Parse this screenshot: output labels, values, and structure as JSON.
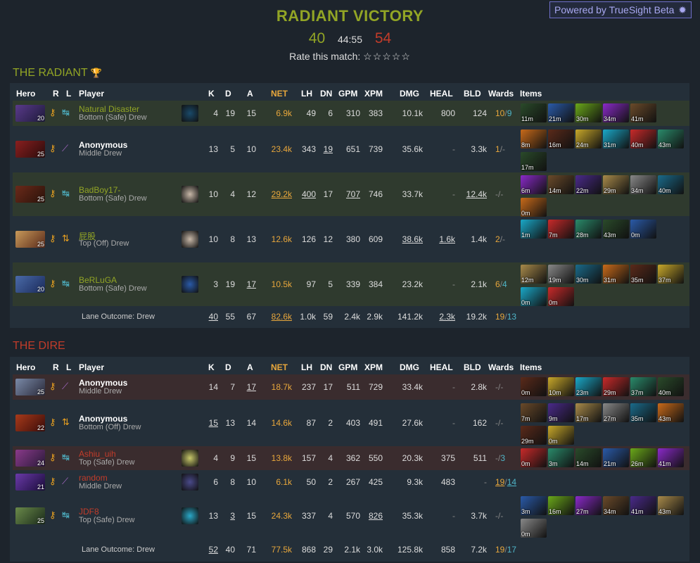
{
  "header": {
    "result": "RADIANT VICTORY",
    "radiant_score": "40",
    "duration": "44:55",
    "dire_score": "54",
    "rate_label": "Rate this match:",
    "stars": "☆☆☆☆☆",
    "powered": "Powered by TrueSight Beta"
  },
  "columns": {
    "hero": "Hero",
    "r": "R",
    "l": "L",
    "player": "Player",
    "k": "K",
    "d": "D",
    "a": "A",
    "net": "NET",
    "lh": "LH",
    "dn": "DN",
    "gpm": "GPM",
    "xpm": "XPM",
    "dmg": "DMG",
    "heal": "HEAL",
    "bld": "BLD",
    "wards": "Wards",
    "items": "Items"
  },
  "radiant": {
    "title": "THE RADIANT",
    "trophy": "🏆",
    "footer": {
      "label": "Lane Outcome: Drew",
      "k": "40",
      "d": "55",
      "a": "67",
      "net": "82.6k",
      "lh": "1.0k",
      "dn": "59",
      "gpm": "2.4k",
      "xpm": "2.9k",
      "dmg": "141.2k",
      "heal": "2.3k",
      "bld": "19.2k",
      "w1": "19",
      "w2": "13"
    },
    "players": [
      {
        "name": "Natural Disaster",
        "sub": "Bottom (Safe) Drew",
        "lvl": "20",
        "k": "4",
        "d": "19",
        "a": "15",
        "net": "6.9k",
        "lh": "49",
        "dn": "6",
        "gpm": "310",
        "xpm": "383",
        "dmg": "10.1k",
        "heal": "800",
        "bld": "124",
        "w1": "10",
        "w2": "9",
        "times": [
          "11m",
          "21m",
          "30m",
          "34m",
          "41m"
        ]
      },
      {
        "name": "Anonymous",
        "sub": "Middle Drew",
        "lvl": "25",
        "k": "13",
        "d": "5",
        "a": "10",
        "net": "23.4k",
        "lh": "343",
        "dn": "19",
        "gpm": "651",
        "xpm": "739",
        "dmg": "35.6k",
        "heal": "-",
        "bld": "3.3k",
        "w1": "1",
        "w2": "-",
        "times": [
          "8m",
          "16m",
          "24m",
          "31m",
          "40m",
          "43m",
          "17m"
        ]
      },
      {
        "name": "BadBoy17-",
        "sub": "Bottom (Safe) Drew",
        "lvl": "25",
        "k": "10",
        "d": "4",
        "a": "12",
        "net": "29.2k",
        "lh": "400",
        "dn": "17",
        "gpm": "707",
        "xpm": "746",
        "dmg": "33.7k",
        "heal": "-",
        "bld": "12.4k",
        "w1": "-",
        "w2": "-",
        "times": [
          "6m",
          "14m",
          "22m",
          "29m",
          "34m",
          "40m",
          "0m"
        ]
      },
      {
        "name": "屁股",
        "sub": "Top (Off) Drew",
        "lvl": "25",
        "k": "10",
        "d": "8",
        "a": "13",
        "net": "12.6k",
        "lh": "126",
        "dn": "12",
        "gpm": "380",
        "xpm": "609",
        "dmg": "38.6k",
        "heal": "1.6k",
        "bld": "1.4k",
        "w1": "2",
        "w2": "-",
        "times": [
          "1m",
          "7m",
          "28m",
          "43m",
          "0m"
        ]
      },
      {
        "name": "BeRLuGA",
        "sub": "Bottom (Safe) Drew",
        "lvl": "20",
        "k": "3",
        "d": "19",
        "a": "17",
        "net": "10.5k",
        "lh": "97",
        "dn": "5",
        "gpm": "339",
        "xpm": "384",
        "dmg": "23.2k",
        "heal": "-",
        "bld": "2.1k",
        "w1": "6",
        "w2": "4",
        "times": [
          "12m",
          "19m",
          "30m",
          "31m",
          "35m",
          "37m",
          "0m",
          "0m"
        ]
      }
    ]
  },
  "dire": {
    "title": "THE DIRE",
    "footer": {
      "label": "Lane Outcome: Drew",
      "k": "52",
      "d": "40",
      "a": "71",
      "net": "77.5k",
      "lh": "868",
      "dn": "29",
      "gpm": "2.1k",
      "xpm": "3.0k",
      "dmg": "125.8k",
      "heal": "858",
      "bld": "7.2k",
      "w1": "19",
      "w2": "17"
    },
    "players": [
      {
        "name": "Anonymous",
        "sub": "Middle Drew",
        "lvl": "25",
        "k": "14",
        "d": "7",
        "a": "17",
        "net": "18.7k",
        "lh": "237",
        "dn": "17",
        "gpm": "511",
        "xpm": "729",
        "dmg": "33.4k",
        "heal": "-",
        "bld": "2.8k",
        "w1": "-",
        "w2": "-",
        "times": [
          "0m",
          "10m",
          "23m",
          "29m",
          "37m",
          "40m"
        ]
      },
      {
        "name": "Anonymous",
        "sub": "Bottom (Off) Drew",
        "lvl": "22",
        "k": "15",
        "d": "13",
        "a": "14",
        "net": "14.6k",
        "lh": "87",
        "dn": "2",
        "gpm": "403",
        "xpm": "491",
        "dmg": "27.6k",
        "heal": "-",
        "bld": "162",
        "w1": "-",
        "w2": "-",
        "times": [
          "7m",
          "9m",
          "17m",
          "27m",
          "35m",
          "43m",
          "29m",
          "0m"
        ]
      },
      {
        "name": "Ashiu_uih",
        "sub": "Top (Safe) Drew",
        "lvl": "24",
        "k": "4",
        "d": "9",
        "a": "15",
        "net": "13.8k",
        "lh": "157",
        "dn": "4",
        "gpm": "362",
        "xpm": "550",
        "dmg": "20.3k",
        "heal": "375",
        "bld": "511",
        "w1": "-",
        "w2": "3",
        "times": [
          "0m",
          "3m",
          "14m",
          "21m",
          "26m",
          "41m"
        ]
      },
      {
        "name": "random",
        "sub": "Middle Drew",
        "lvl": "21",
        "k": "6",
        "d": "8",
        "a": "10",
        "net": "6.1k",
        "lh": "50",
        "dn": "2",
        "gpm": "267",
        "xpm": "425",
        "dmg": "9.3k",
        "heal": "483",
        "bld": "-",
        "w1": "19",
        "w2": "14",
        "times": []
      },
      {
        "name": "JDF8",
        "sub": "Top (Safe) Drew",
        "lvl": "25",
        "k": "13",
        "d": "3",
        "a": "15",
        "net": "24.3k",
        "lh": "337",
        "dn": "4",
        "gpm": "570",
        "xpm": "826",
        "dmg": "35.3k",
        "heal": "-",
        "bld": "3.7k",
        "w1": "-",
        "w2": "-",
        "times": [
          "3m",
          "16m",
          "27m",
          "34m",
          "41m",
          "43m",
          "0m"
        ]
      }
    ]
  },
  "colors": {
    "radiant": "#92a525",
    "dire": "#c23c2a",
    "gold": "#e8a73c",
    "accent": "#4fb5c8"
  }
}
